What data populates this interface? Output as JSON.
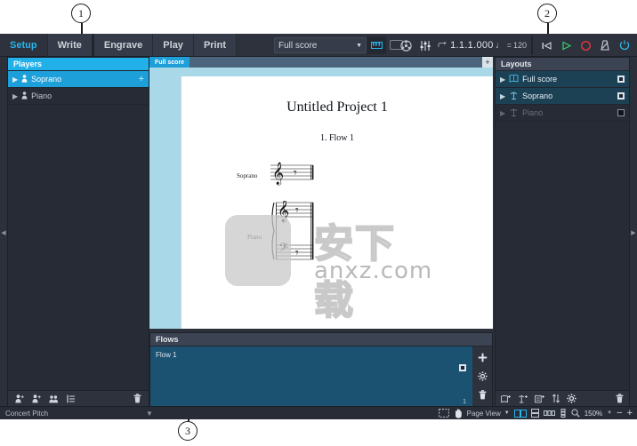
{
  "app": {
    "mode_tabs": [
      {
        "label": "Setup",
        "active": true
      },
      {
        "label": "Write",
        "active": false
      },
      {
        "label": "Engrave",
        "active": false
      },
      {
        "label": "Play",
        "active": false
      },
      {
        "label": "Print",
        "active": false
      }
    ],
    "score_selector": {
      "value": "Full score",
      "chevron": "chevron-down-icon"
    },
    "toolbar_icons": [
      {
        "name": "keyboard-panel-icon"
      },
      {
        "name": "window-layout-icon"
      },
      {
        "name": "mixer-icon"
      },
      {
        "name": "mixer-faders-icon"
      },
      {
        "name": "loop-icon"
      }
    ],
    "transport": {
      "timecode": "1.1.1.000",
      "tempo_note": "♩",
      "tempo_equals": "=",
      "tempo_value": "120",
      "buttons": [
        {
          "name": "go-to-start-button",
          "glyph": "⏮"
        },
        {
          "name": "play-button",
          "glyph": "▶"
        },
        {
          "name": "record-button",
          "glyph": "●"
        },
        {
          "name": "metronome-button",
          "glyph": "⩞"
        },
        {
          "name": "power-button",
          "glyph": "⏻"
        }
      ]
    }
  },
  "players": {
    "title": "Players",
    "items": [
      {
        "label": "Soprano",
        "selected": true,
        "add": "+"
      },
      {
        "label": "Piano",
        "selected": false,
        "add": ""
      }
    ],
    "footer_icons": [
      "add-solo-player-icon",
      "add-section-player-icon",
      "add-ensemble-icon",
      "player-list-icon",
      "delete-player-icon"
    ]
  },
  "layouts": {
    "title": "Layouts",
    "items": [
      {
        "label": "Full score",
        "icon": "full-score-icon",
        "selected": true,
        "checked": true
      },
      {
        "label": "Soprano",
        "icon": "part-layout-icon",
        "selected": true,
        "checked": true
      },
      {
        "label": "Piano",
        "icon": "part-layout-icon",
        "selected": false,
        "checked": false
      }
    ],
    "footer_icons": [
      "add-full-score-layout-icon",
      "add-part-layout-icon",
      "add-custom-layout-icon",
      "sort-layouts-icon",
      "layout-options-icon",
      "delete-layout-icon"
    ]
  },
  "flows": {
    "title": "Flows",
    "items": [
      {
        "label": "Flow 1",
        "selected": true,
        "checked": true
      }
    ],
    "count": "1",
    "buttons": [
      "add-flow-icon",
      "flow-options-icon",
      "delete-flow-icon"
    ]
  },
  "score": {
    "tab_label": "Full score",
    "add_tab": "+",
    "document_title": "Untitled Project 1",
    "flow_heading": "1. Flow 1",
    "staff_labels": [
      "Soprano",
      "Piano"
    ]
  },
  "status_bar": {
    "pitch_mode": "Concert Pitch",
    "chevron": "chevron-down-icon",
    "view_mode": "Page View",
    "zoom_level": "150%",
    "zoom_out": "−",
    "zoom_in": "+",
    "tools": [
      "marquee-select-icon",
      "hand-tool-icon",
      "spreads-view-icon",
      "single-page-icon",
      "gallery-view-icon",
      "page-arrangement-icon",
      "zoom-icon"
    ]
  },
  "callouts": [
    {
      "number": "1",
      "target": "players-panel"
    },
    {
      "number": "2",
      "target": "layouts-panel"
    },
    {
      "number": "3",
      "target": "flows-panel"
    }
  ],
  "watermark": {
    "chinese": "安下载",
    "domain": "anxz.com"
  },
  "colors": {
    "accent": "#1d9fda",
    "tab_active": "#2ab4ea",
    "panel_bg": "#262b35",
    "chrome": "#2d323d"
  }
}
